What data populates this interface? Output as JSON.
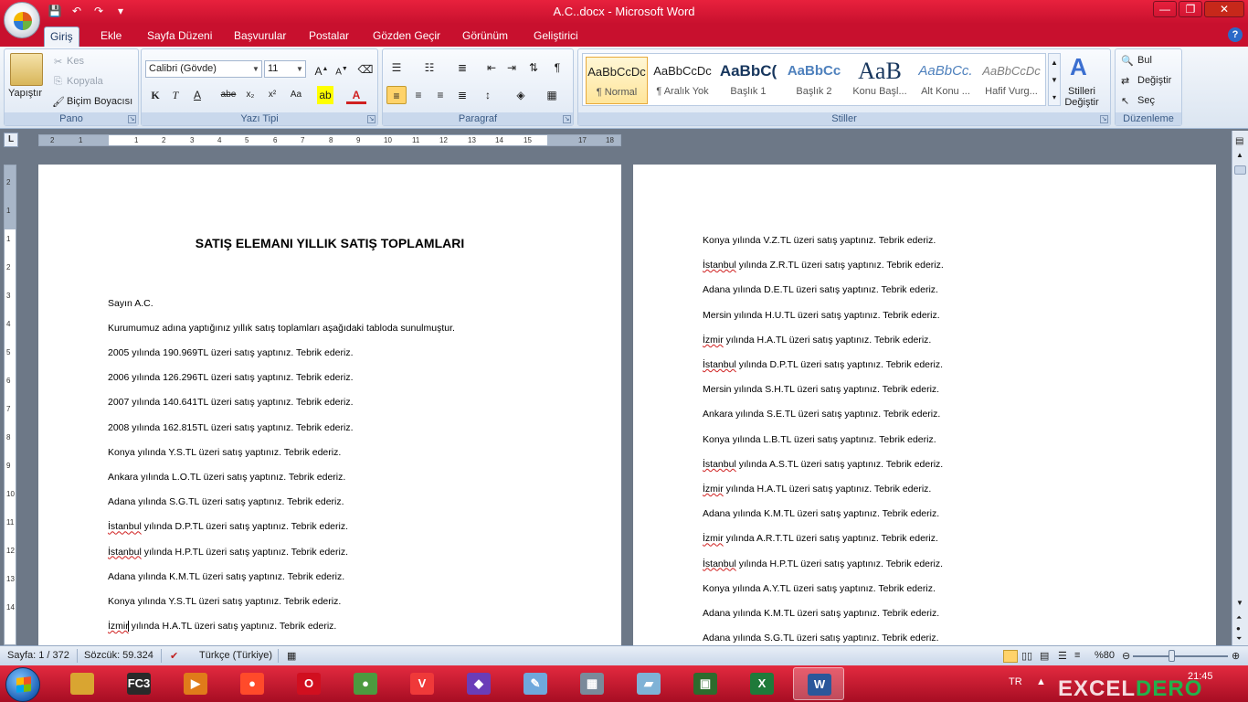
{
  "window": {
    "title": "A.C..docx - Microsoft Word",
    "controls": {
      "minimize": "—",
      "maximize": "❐",
      "close": "✕"
    }
  },
  "tabs": [
    "Giriş",
    "Ekle",
    "Sayfa Düzeni",
    "Başvurular",
    "Postalar",
    "Gözden Geçir",
    "Görünüm",
    "Geliştirici"
  ],
  "ribbon": {
    "pano": {
      "label": "Pano",
      "paste": "Yapıştır",
      "cut": "Kes",
      "copy": "Kopyala",
      "format_painter": "Biçim Boyacısı"
    },
    "font": {
      "label": "Yazı Tipi",
      "name": "Calibri (Gövde)",
      "size": "11",
      "bold": "K",
      "italic": "T",
      "underline": "A",
      "strike": "abe",
      "subscript": "x₂",
      "superscript": "x²",
      "case": "Aa"
    },
    "paragraph": {
      "label": "Paragraf",
      "pilcrow": "¶"
    },
    "styles": {
      "label": "Stiller",
      "items": [
        {
          "sample": "AaBbCcDc",
          "name": "¶ Normal"
        },
        {
          "sample": "AaBbCcDc",
          "name": "¶ Aralık Yok"
        },
        {
          "sample": "AaBbC(",
          "name": "Başlık 1"
        },
        {
          "sample": "AaBbCc",
          "name": "Başlık 2"
        },
        {
          "sample": "AaB",
          "name": "Konu Başl..."
        },
        {
          "sample": "AaBbCc.",
          "name": "Alt Konu ..."
        },
        {
          "sample": "AaBbCcDc",
          "name": "Hafif Vurg..."
        }
      ],
      "change_styles": "Stilleri Değiştir"
    },
    "editing": {
      "label": "Düzenleme",
      "find": "Bul",
      "replace": "Değiştir",
      "select": "Seç"
    }
  },
  "ruler": {
    "numbers": [
      "2",
      "1",
      "1",
      "2",
      "3",
      "4",
      "5",
      "6",
      "7",
      "8",
      "9",
      "10",
      "11",
      "12",
      "13",
      "14",
      "15",
      "17",
      "18"
    ],
    "vnumbers": [
      "2",
      "1",
      "1",
      "2",
      "3",
      "4",
      "5",
      "6",
      "7",
      "8",
      "9",
      "10",
      "11",
      "12",
      "13",
      "14"
    ]
  },
  "page1": {
    "title": "SATIŞ ELEMANI YILLIK SATIŞ TOPLAMLARI",
    "greeting": "Sayın A.C.",
    "intro": "Kurumumuz adına yaptığınız yıllık satış toplamları aşağıdaki tabloda sunulmuştur.",
    "lines": [
      {
        "pre": "",
        "word": "",
        "post": "2005 yılında 190.969TL üzeri satış yaptınız. Tebrik ederiz."
      },
      {
        "pre": "",
        "word": "",
        "post": "2006 yılında 126.296TL üzeri satış yaptınız. Tebrik ederiz."
      },
      {
        "pre": "",
        "word": "",
        "post": "2007 yılında 140.641TL üzeri satış yaptınız. Tebrik ederiz."
      },
      {
        "pre": "",
        "word": "",
        "post": "2008 yılında 162.815TL üzeri satış yaptınız. Tebrik ederiz."
      },
      {
        "pre": "",
        "word": "",
        "post": "Konya yılında Y.S.TL üzeri satış yaptınız. Tebrik ederiz."
      },
      {
        "pre": "",
        "word": "",
        "post": "Ankara yılında L.O.TL üzeri satış yaptınız. Tebrik ederiz."
      },
      {
        "pre": "",
        "word": "",
        "post": "Adana yılında S.G.TL üzeri satış yaptınız. Tebrik ederiz."
      },
      {
        "pre": "",
        "word": "İstanbul",
        "post": " yılında D.P.TL üzeri satış yaptınız. Tebrik ederiz."
      },
      {
        "pre": "",
        "word": "İstanbul",
        "post": " yılında H.P.TL üzeri satış yaptınız. Tebrik ederiz."
      },
      {
        "pre": "",
        "word": "",
        "post": "Adana yılında K.M.TL üzeri satış yaptınız. Tebrik ederiz."
      },
      {
        "pre": "",
        "word": "",
        "post": "Konya yılında Y.S.TL üzeri satış yaptınız. Tebrik ederiz."
      },
      {
        "pre": "",
        "word": "İzmir",
        "post": " yılında H.A.TL üzeri satış yaptınız. Tebrik ederiz."
      }
    ]
  },
  "page2": {
    "lines": [
      {
        "word": "",
        "post": "Konya yılında V.Z.TL üzeri satış yaptınız. Tebrik ederiz."
      },
      {
        "word": "İstanbul",
        "post": " yılında Z.R.TL üzeri satış yaptınız. Tebrik ederiz."
      },
      {
        "word": "",
        "post": "Adana yılında D.E.TL üzeri satış yaptınız. Tebrik ederiz."
      },
      {
        "word": "",
        "post": "Mersin yılında H.U.TL üzeri satış yaptınız. Tebrik ederiz."
      },
      {
        "word": "İzmir",
        "post": " yılında H.A.TL üzeri satış yaptınız. Tebrik ederiz."
      },
      {
        "word": "İstanbul",
        "post": " yılında D.P.TL üzeri satış yaptınız. Tebrik ederiz."
      },
      {
        "word": "",
        "post": "Mersin yılında S.H.TL üzeri satış yaptınız. Tebrik ederiz."
      },
      {
        "word": "",
        "post": "Ankara yılında S.E.TL üzeri satış yaptınız. Tebrik ederiz."
      },
      {
        "word": "",
        "post": "Konya yılında L.B.TL üzeri satış yaptınız. Tebrik ederiz."
      },
      {
        "word": "İstanbul",
        "post": " yılında A.S.TL üzeri satış yaptınız. Tebrik ederiz."
      },
      {
        "word": "İzmir",
        "post": " yılında H.A.TL üzeri satış yaptınız. Tebrik ederiz."
      },
      {
        "word": "",
        "post": "Adana yılında K.M.TL üzeri satış yaptınız. Tebrik ederiz."
      },
      {
        "word": "İzmir",
        "post": " yılında A.R.T.TL üzeri satış yaptınız. Tebrik ederiz."
      },
      {
        "word": "İstanbul",
        "post": " yılında H.P.TL üzeri satış yaptınız. Tebrik ederiz."
      },
      {
        "word": "",
        "post": "Konya yılında A.Y.TL üzeri satış yaptınız. Tebrik ederiz."
      },
      {
        "word": "",
        "post": "Adana yılında K.M.TL üzeri satış yaptınız. Tebrik ederiz."
      },
      {
        "word": "",
        "post": "Adana yılında S.G.TL üzeri satış yaptınız. Tebrik ederiz."
      }
    ]
  },
  "status": {
    "page": "Sayfa: 1 / 372",
    "words": "Sözcük: 59.324",
    "language": "Türkçe (Türkiye)",
    "zoom": "%80",
    "zoom_level": 0.8
  },
  "taskbar": {
    "apps": [
      {
        "icon": "folder-icon",
        "label": "",
        "color": "#d9a531"
      },
      {
        "icon": "fc3-icon",
        "label": "FC3",
        "color": "#2a2a2a"
      },
      {
        "icon": "media-player-icon",
        "label": "▶",
        "color": "#e07b1a"
      },
      {
        "icon": "record-icon",
        "label": "●",
        "color": "#ff4a2a"
      },
      {
        "icon": "opera-icon",
        "label": "O",
        "color": "#d10f1f"
      },
      {
        "icon": "chrome-icon",
        "label": "●",
        "color": "#4c9a3f"
      },
      {
        "icon": "vivaldi-icon",
        "label": "V",
        "color": "#ef3939"
      },
      {
        "icon": "visual-studio-icon",
        "label": "◆",
        "color": "#6a3db8"
      },
      {
        "icon": "paint-icon",
        "label": "✎",
        "color": "#6fa8dc"
      },
      {
        "icon": "calculator-icon",
        "label": "▦",
        "color": "#7a8a9a"
      },
      {
        "icon": "notes-icon",
        "label": "▰",
        "color": "#7fb2d6"
      },
      {
        "icon": "terminal-icon",
        "label": "▣",
        "color": "#2d6b2d"
      },
      {
        "icon": "excel-icon",
        "label": "X",
        "color": "#1f7a3a"
      },
      {
        "icon": "word-icon",
        "label": "W",
        "color": "#2b579a"
      }
    ],
    "lang": "TR",
    "time": "21:45",
    "watermark_a": "EXCEL",
    "watermark_b": "DERO"
  }
}
